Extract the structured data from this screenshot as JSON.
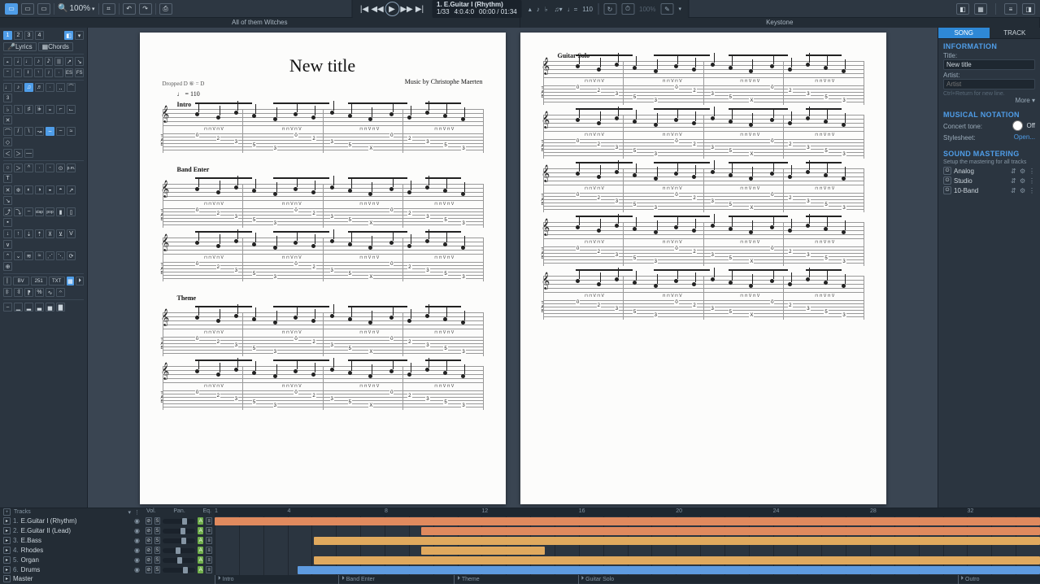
{
  "toolbar": {
    "zoom": "100%",
    "view_buttons": [
      "page",
      "screen",
      "grid"
    ]
  },
  "transport": {
    "track_label": "1. E.Guitar I (Rhythm)",
    "bar_pos": "1/33",
    "time_sig": "4:0.4:0",
    "time": "00:00 / 01:34",
    "tempo": "110",
    "metronome_icons": [
      "loop",
      "metronome",
      "speed",
      "tuner"
    ]
  },
  "songstrip": {
    "left": "All of them Witches",
    "right": "Keystone"
  },
  "left_tabs": {
    "active": "1",
    "nums": [
      "1",
      "2",
      "3",
      "4"
    ]
  },
  "left_buttons": {
    "lyrics": "Lyrics",
    "chords": "Chords"
  },
  "tool_labels": {
    "BV": "BV",
    "n251": "251",
    "TXT": "TXT",
    "pm": "p.m.",
    "slap": "slap",
    "pop": "pop"
  },
  "score": {
    "title": "New title",
    "credit": "Music by Christophe Maerten",
    "tuning": "Dropped D\n⑥ = D",
    "tempo": "♩ = 110",
    "sections_page1": [
      "Intro",
      "Band Enter",
      "Theme"
    ],
    "sections_page2": [
      "Guitar Solo"
    ]
  },
  "rpanel": {
    "tabs": [
      "SONG",
      "TRACK"
    ],
    "info_h": "INFORMATION",
    "title_lbl": "Title:",
    "title_val": "New title",
    "artist_lbl": "Artist:",
    "artist_val": "Artist",
    "hint": "Ctrl+Return for new line.",
    "more": "More ▾",
    "notation_h": "MUSICAL NOTATION",
    "concert_lbl": "Concert tone:",
    "concert_off": "Off",
    "stylesheet_lbl": "Stylesheet:",
    "stylesheet_val": "Open...",
    "master_h": "SOUND MASTERING",
    "master_sub": "Setup the mastering for all tracks",
    "mastering": [
      "Analog",
      "Studio",
      "10-Band"
    ]
  },
  "bottom": {
    "tracks_dd": "Tracks",
    "cols": [
      "Vol.",
      "Pan.",
      "Eq."
    ],
    "ruler": [
      1,
      4,
      8,
      12,
      16,
      20,
      24,
      28,
      32
    ],
    "tracks": [
      {
        "n": "1.",
        "name": "E.Guitar I (Rhythm)",
        "color": "c1",
        "clips": [
          [
            0,
            100
          ]
        ],
        "knob": 60
      },
      {
        "n": "2.",
        "name": "E.Guitar II (Lead)",
        "color": "c1",
        "clips": [
          [
            25,
            100
          ]
        ],
        "knob": 55
      },
      {
        "n": "3.",
        "name": "E.Bass",
        "color": "c2",
        "clips": [
          [
            12,
            100
          ]
        ],
        "knob": 58
      },
      {
        "n": "4.",
        "name": "Rhodes",
        "color": "c2",
        "clips": [
          [
            25,
            40
          ]
        ],
        "knob": 40
      },
      {
        "n": "5.",
        "name": "Organ",
        "color": "c2",
        "clips": [
          [
            12,
            100
          ]
        ],
        "knob": 45
      },
      {
        "n": "6.",
        "name": "Drums",
        "color": "c3",
        "clips": [
          [
            10,
            100
          ]
        ],
        "knob": 62
      }
    ],
    "master": "Master",
    "sections": [
      {
        "pos": 0,
        "label": "Intro"
      },
      {
        "pos": 15,
        "label": "Band Enter"
      },
      {
        "pos": 29,
        "label": "Theme"
      },
      {
        "pos": 44,
        "label": "Guitar Solo"
      },
      {
        "pos": 90,
        "label": "Outro"
      }
    ]
  }
}
